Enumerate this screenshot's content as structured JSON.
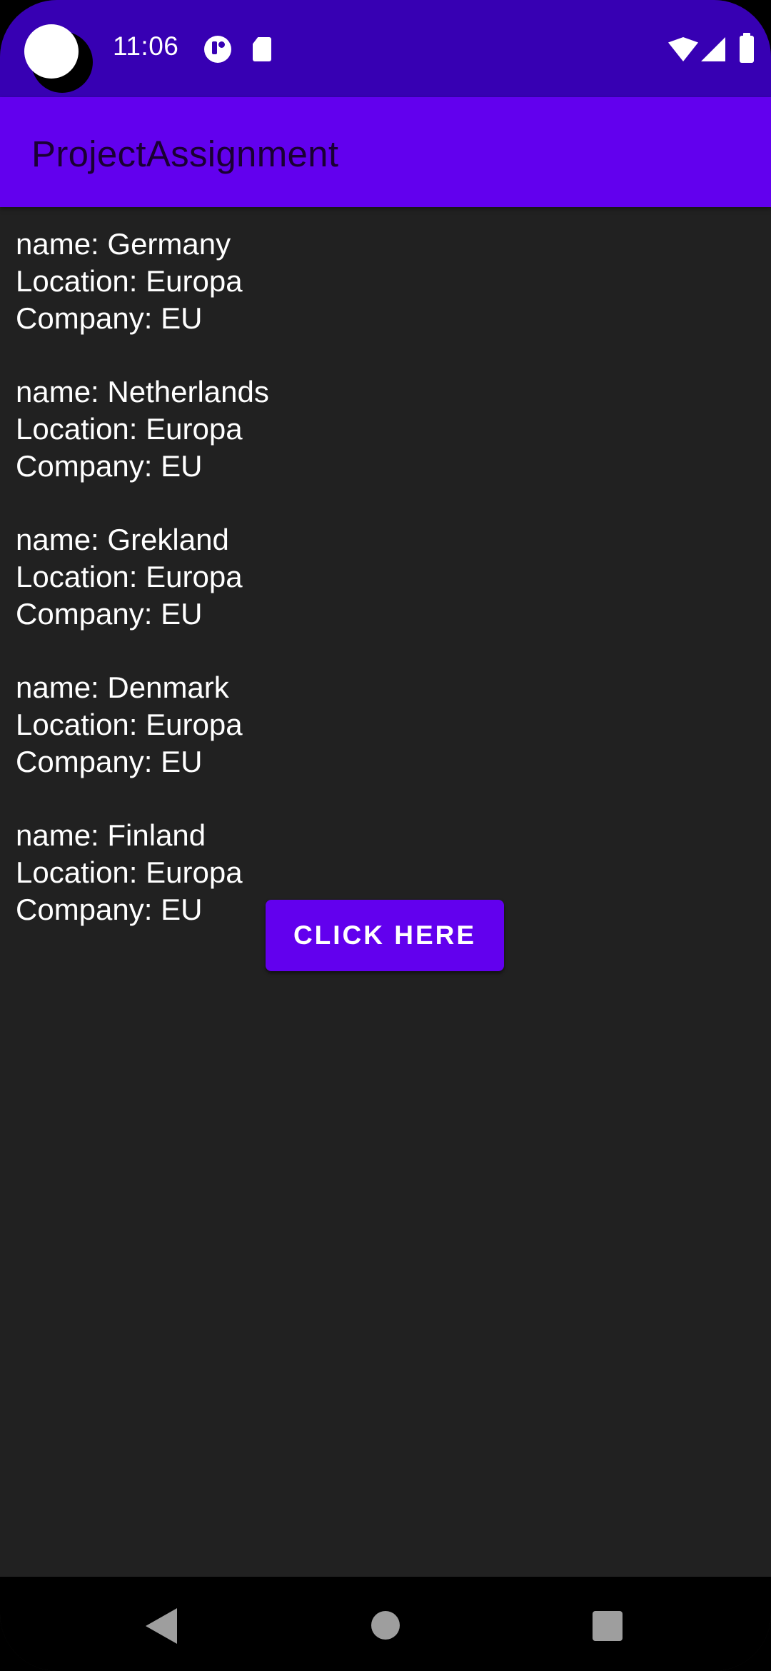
{
  "status_bar": {
    "time": "11:06",
    "icons": [
      "notification-app-icon",
      "sd-card-icon",
      "wifi-icon",
      "signal-icon",
      "battery-icon"
    ]
  },
  "app_bar": {
    "title": "ProjectAssignment"
  },
  "records": [
    {
      "name": "name: Germany",
      "location": "Location: Europa",
      "company": "Company: EU"
    },
    {
      "name": "name: Netherlands",
      "location": "Location: Europa",
      "company": "Company: EU"
    },
    {
      "name": "name: Grekland",
      "location": "Location: Europa",
      "company": "Company: EU"
    },
    {
      "name": "name: Denmark",
      "location": "Location: Europa",
      "company": "Company: EU"
    },
    {
      "name": "name: Finland",
      "location": "Location: Europa",
      "company": "Company: EU"
    }
  ],
  "button": {
    "label": "CLICK HERE"
  },
  "nav_bar": {
    "icons": [
      "back-icon",
      "home-icon",
      "recents-icon"
    ]
  },
  "colors": {
    "status_bar": "#3700B3",
    "app_bar": "#6200EE",
    "background": "#212121",
    "button": "#6200EE"
  }
}
